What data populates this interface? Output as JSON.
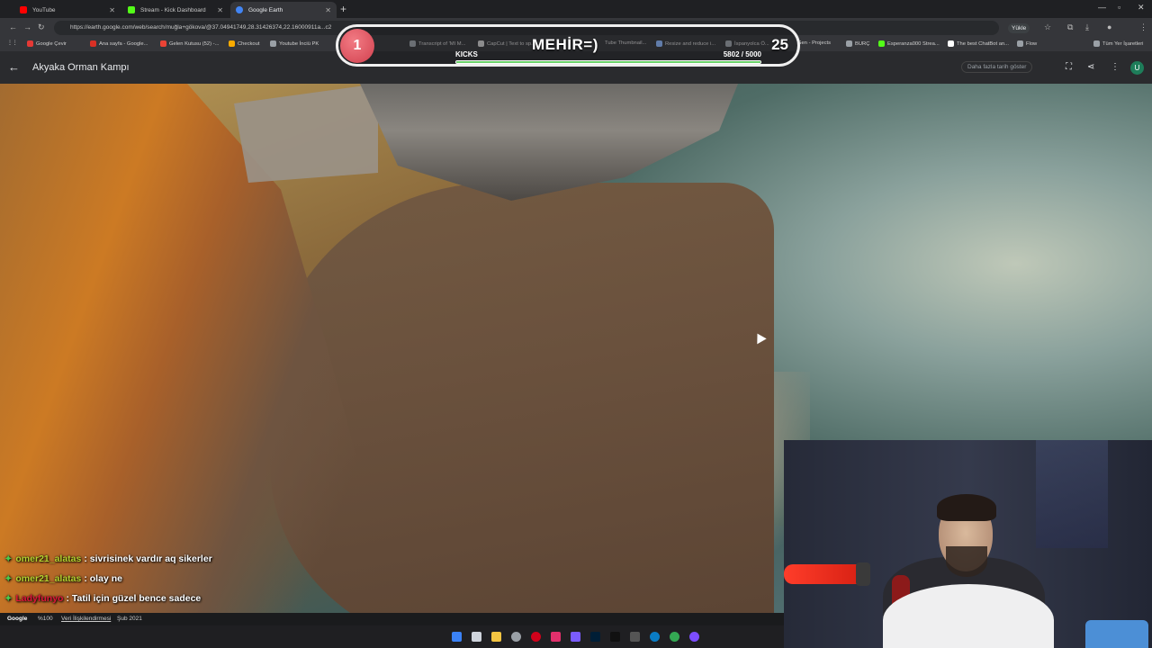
{
  "tabs": [
    {
      "label": "YouTube",
      "color": "#ff0000"
    },
    {
      "label": "Stream - Kick Dashboard",
      "color": "#53fc18"
    },
    {
      "label": "Google Earth",
      "color": "#4285f4"
    }
  ],
  "address": {
    "url": "https://earth.google.com/web/search/muğla+gökova/@37.04941749,28.31426374,22.16000911a...c2",
    "upload_label": "Yükle"
  },
  "bookmarks": [
    "Google Çevir",
    "Ana sayfa - Google...",
    "Gelen Kutusu (52) -...",
    "Checkout",
    "Youtube İnciü PK",
    "Transcript of 'MI M...",
    "CapCut | Text to sp...",
    "Tube Thumbnail...",
    "Resize and reduce i...",
    "İspanyolca Ö...",
    "Gen - Projects",
    "BURÇ",
    "Esperanza000 Strea...",
    "The best ChatBot an...",
    "Flow",
    "Tüm Yer İşaretleri"
  ],
  "earth": {
    "title": "Akyaka Orman Kampı",
    "history_label": "Daha fazla tarih göster",
    "avatar_letter": "U"
  },
  "overlay": {
    "rank": "1",
    "name": "MEHİR=)",
    "count": "25",
    "kicks_label": "KICKS",
    "progress_text": "5802 / 5000",
    "progress_fraction": 1.0
  },
  "chat": [
    {
      "user": "omer21_alatas",
      "text": ": sivrisinek vardır aq sikerler",
      "user_color": "#b6d12f"
    },
    {
      "user": "omer21_alatas",
      "text": ": olay ne",
      "user_color": "#b6d12f"
    },
    {
      "user": "Ladyfunyo",
      "text": ": Tatil için güzel bence sadece",
      "user_color": "#e0163a"
    }
  ],
  "footer": {
    "brand": "Google",
    "zoom": "%100",
    "data_label": "Veri İlişkilendirmesi",
    "date": "Şub 2021"
  }
}
